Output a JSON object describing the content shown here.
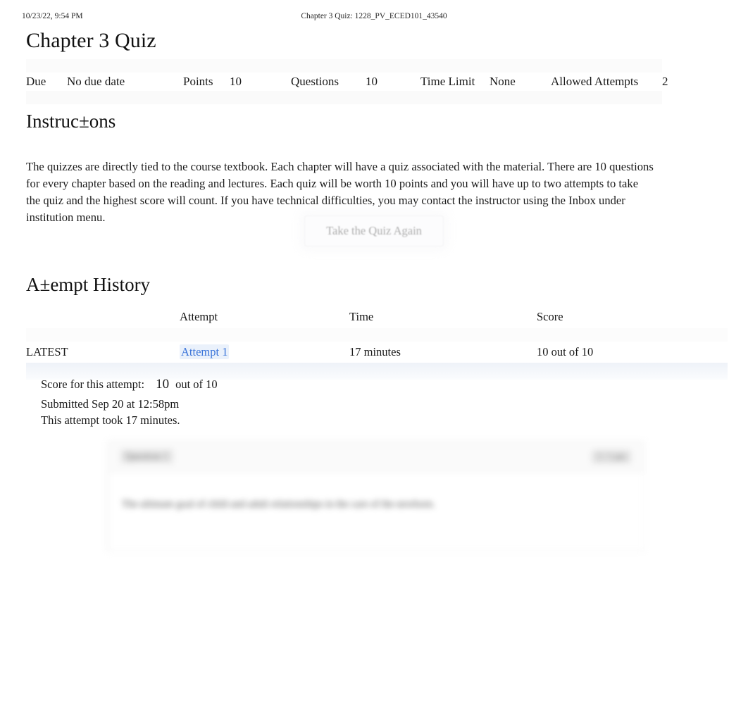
{
  "print_header": {
    "timestamp": "10/23/22, 9:54 PM",
    "document_title": "Chapter 3 Quiz: 1228_PV_ECED101_43540"
  },
  "quiz": {
    "title": "Chapter 3 Quiz",
    "meta": {
      "due_label": "Due",
      "due_value": "No due date",
      "points_label": "Points",
      "points_value": "10",
      "questions_label": "Questions",
      "questions_value": "10",
      "time_limit_label": "Time Limit",
      "time_limit_value": "None",
      "allowed_attempts_label": "Allowed Attempts",
      "allowed_attempts_value": "2"
    },
    "instructions": {
      "heading": "Instruc±ons",
      "body": "The quizzes are directly tied to the course textbook. Each chapter will have a quiz associated with the material. There are 10 questions for every chapter based on the reading and lectures. Each quiz will be worth 10 points and you will have up to two attempts to take the quiz and the highest score will count. If you have technical difficulties, you may contact the instructor using the Inbox under institution menu."
    },
    "retake_button_label": "Take the Quiz Again"
  },
  "attempt_history": {
    "heading": "A±empt History",
    "columns": [
      "",
      "Attempt",
      "Time",
      "Score"
    ],
    "rows": [
      {
        "marker": "LATEST",
        "attempt": "Attempt 1",
        "time": "17 minutes",
        "score": "10 out of 10"
      }
    ]
  },
  "score_summary": {
    "score_label": "Score for this attempt:",
    "score_value": "10",
    "score_suffix": "out of 10",
    "submitted": "Submitted Sep 20 at 12:58pm",
    "duration": "This attempt took 17 minutes."
  },
  "question_card": {
    "question_label": "Question 1",
    "points": "1 / 1 pts",
    "question_text": "The ultimate goal of child and adult relationships in the care of the newborn."
  },
  "colors": {
    "link_blue": "#3d76da",
    "link_highlight": "#eaf1fb",
    "text": "#1a1a1a",
    "band_blue": "#f3f6fa",
    "muted": "#a8a8a8"
  }
}
